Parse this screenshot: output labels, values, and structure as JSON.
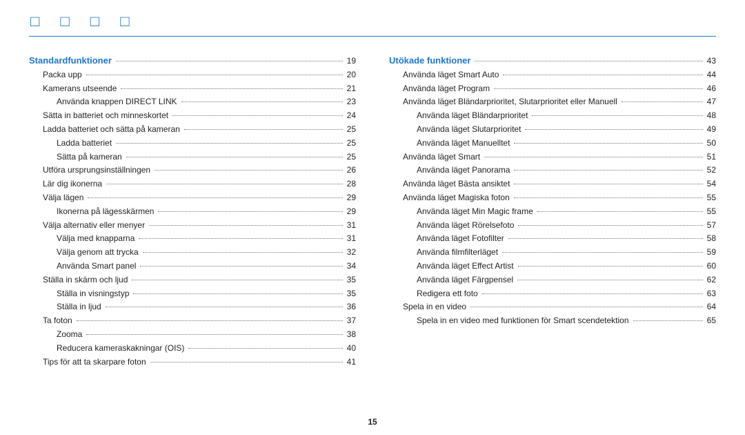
{
  "footer_page": "15",
  "title_glyphs": "□  □  □  □",
  "left": {
    "heading": {
      "label": "Standardfunktioner",
      "page": "19",
      "level": 0,
      "head": true
    },
    "items": [
      {
        "label": "Packa upp",
        "page": "20",
        "level": 1
      },
      {
        "label": "Kamerans utseende",
        "page": "21",
        "level": 1
      },
      {
        "label": "Använda knappen DIRECT LINK",
        "page": "23",
        "level": 2
      },
      {
        "label": "Sätta in batteriet och minneskortet",
        "page": "24",
        "level": 1
      },
      {
        "label": "Ladda batteriet och sätta på kameran",
        "page": "25",
        "level": 1
      },
      {
        "label": "Ladda batteriet",
        "page": "25",
        "level": 2
      },
      {
        "label": "Sätta på kameran",
        "page": "25",
        "level": 2
      },
      {
        "label": "Utföra ursprungsinställningen",
        "page": "26",
        "level": 1
      },
      {
        "label": "Lär dig ikonerna",
        "page": "28",
        "level": 1
      },
      {
        "label": "Välja lägen",
        "page": "29",
        "level": 1
      },
      {
        "label": "Ikonerna på lägesskärmen",
        "page": "29",
        "level": 2
      },
      {
        "label": "Välja alternativ eller menyer",
        "page": "31",
        "level": 1
      },
      {
        "label": "Välja med knapparna",
        "page": "31",
        "level": 2
      },
      {
        "label": "Välja genom att trycka",
        "page": "32",
        "level": 2
      },
      {
        "label": "Använda Smart panel",
        "page": "34",
        "level": 2
      },
      {
        "label": "Ställa in skärm och ljud",
        "page": "35",
        "level": 1
      },
      {
        "label": "Ställa in visningstyp",
        "page": "35",
        "level": 2
      },
      {
        "label": "Ställa in ljud",
        "page": "36",
        "level": 2
      },
      {
        "label": "Ta foton",
        "page": "37",
        "level": 1
      },
      {
        "label": "Zooma",
        "page": "38",
        "level": 2
      },
      {
        "label": "Reducera kameraskakningar (OIS)",
        "page": "40",
        "level": 2
      },
      {
        "label": "Tips för att ta skarpare foton",
        "page": "41",
        "level": 1
      }
    ]
  },
  "right": {
    "heading": {
      "label": "Utökade funktioner",
      "page": "43",
      "level": 0,
      "head": true
    },
    "items": [
      {
        "label": "Använda läget Smart Auto",
        "page": "44",
        "level": 1
      },
      {
        "label": "Använda läget Program",
        "page": "46",
        "level": 1
      },
      {
        "label": "Använda läget Bländarprioritet, Slutarprioritet eller Manuell",
        "page": "47",
        "level": 1
      },
      {
        "label": "Använda läget Bländarprioritet",
        "page": "48",
        "level": 2
      },
      {
        "label": "Använda läget Slutarprioritet",
        "page": "49",
        "level": 2
      },
      {
        "label": "Använda läget Manuelltet",
        "page": "50",
        "level": 2
      },
      {
        "label": "Använda läget Smart",
        "page": "51",
        "level": 1
      },
      {
        "label": "Använda läget Panorama",
        "page": "52",
        "level": 2
      },
      {
        "label": "Använda läget Bästa ansiktet",
        "page": "54",
        "level": 1
      },
      {
        "label": "Använda läget Magiska foton",
        "page": "55",
        "level": 1
      },
      {
        "label": "Använda läget Min Magic frame",
        "page": "55",
        "level": 2
      },
      {
        "label": "Använda läget Rörelsefoto",
        "page": "57",
        "level": 2
      },
      {
        "label": "Använda läget Fotofilter",
        "page": "58",
        "level": 2
      },
      {
        "label": "Använda filmfilterläget",
        "page": "59",
        "level": 2
      },
      {
        "label": "Använda läget Effect Artist",
        "page": "60",
        "level": 2
      },
      {
        "label": "Använda läget Färgpensel",
        "page": "62",
        "level": 2
      },
      {
        "label": "Redigera ett foto",
        "page": "63",
        "level": 2
      },
      {
        "label": "Spela in en video",
        "page": "64",
        "level": 1
      },
      {
        "label": "Spela in en video med funktionen för Smart scendetektion",
        "page": "65",
        "level": 2
      }
    ]
  }
}
